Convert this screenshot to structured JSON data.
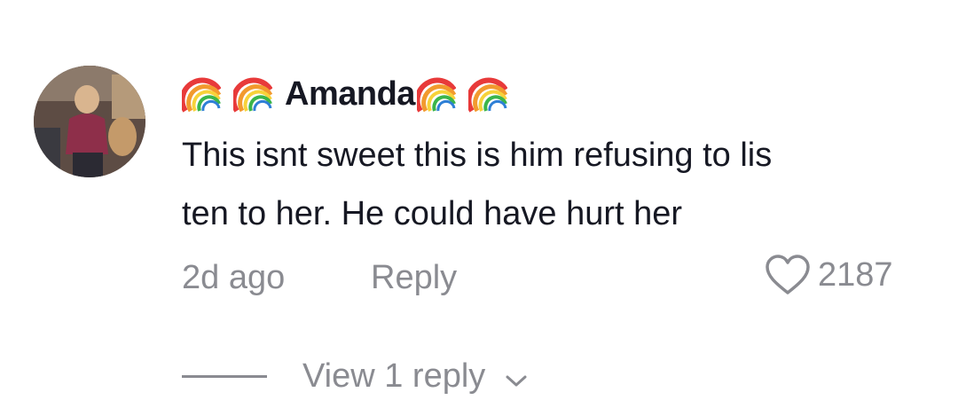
{
  "comment": {
    "username": "Amanda",
    "username_prefix_icons": [
      "rainbow-icon",
      "rainbow-icon"
    ],
    "username_suffix_icons": [
      "rainbow-icon",
      "rainbow-icon"
    ],
    "text_lines": [
      "This isnt sweet this is him refusing to lis",
      "ten to her. He could have hurt her"
    ],
    "time": "2d ago",
    "reply_label": "Reply",
    "like_count": "2187",
    "view_replies_label": "View 1 reply"
  },
  "colors": {
    "text_primary": "#161823",
    "text_secondary": "#8a8b91",
    "background": "#ffffff"
  }
}
